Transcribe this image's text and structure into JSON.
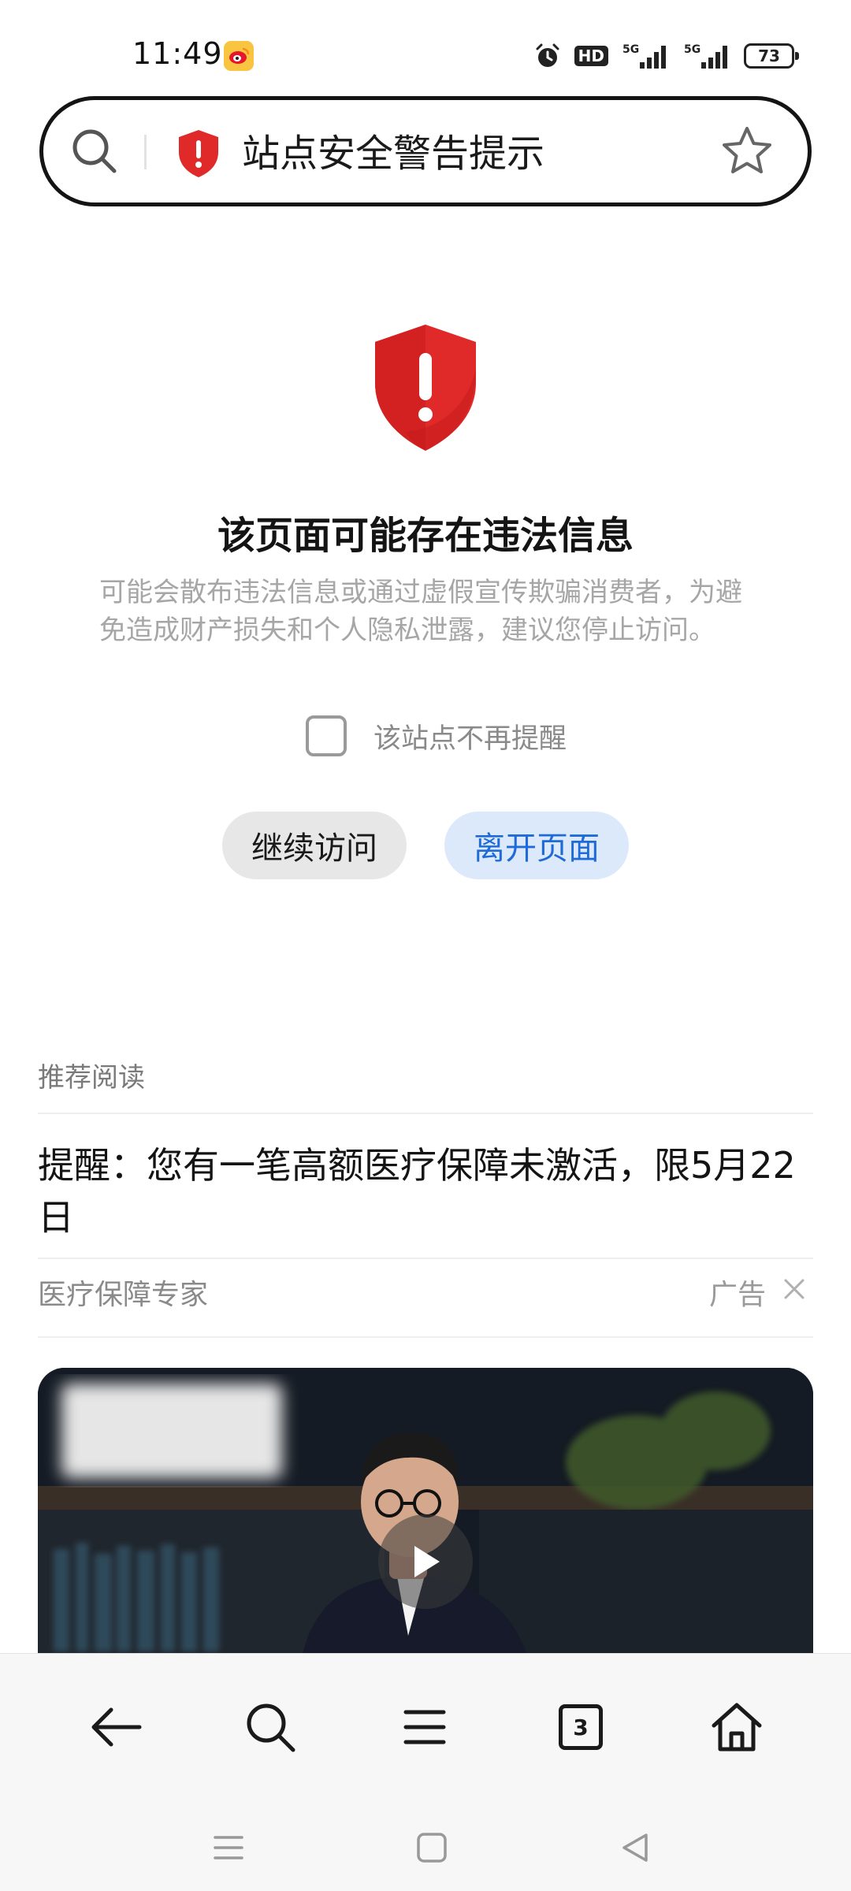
{
  "status_bar": {
    "time": "11:49",
    "hd_label": "HD",
    "battery_level": "73"
  },
  "address_bar": {
    "title": "站点安全警告提示"
  },
  "warning": {
    "title": "该页面可能存在违法信息",
    "description": "可能会散布违法信息或通过虚假宣传欺骗消费者，为避免造成财产损失和个人隐私泄露，建议您停止访问。",
    "checkbox_label": "该站点不再提醒",
    "checkbox_checked": false,
    "continue_label": "继续访问",
    "leave_label": "离开页面"
  },
  "recommended": {
    "heading": "推荐阅读",
    "ad": {
      "title": "提醒：您有一笔高额医疗保障未激活，限5月22日",
      "source": "医疗保障专家",
      "tag": "广告"
    }
  },
  "toolbar": {
    "tab_count": "3"
  },
  "colors": {
    "shield_red": "#e02a2a",
    "leave_button_bg": "#dce9fb",
    "leave_button_text": "#1d6ad8"
  },
  "icons": {
    "address_bar": [
      "search-icon",
      "shield-warning-icon",
      "star-icon"
    ],
    "toolbar": [
      "back-arrow-icon",
      "search-icon",
      "menu-icon",
      "tabs-icon",
      "home-icon"
    ],
    "system_nav": [
      "recents-icon",
      "home-square-icon",
      "back-triangle-icon"
    ]
  }
}
